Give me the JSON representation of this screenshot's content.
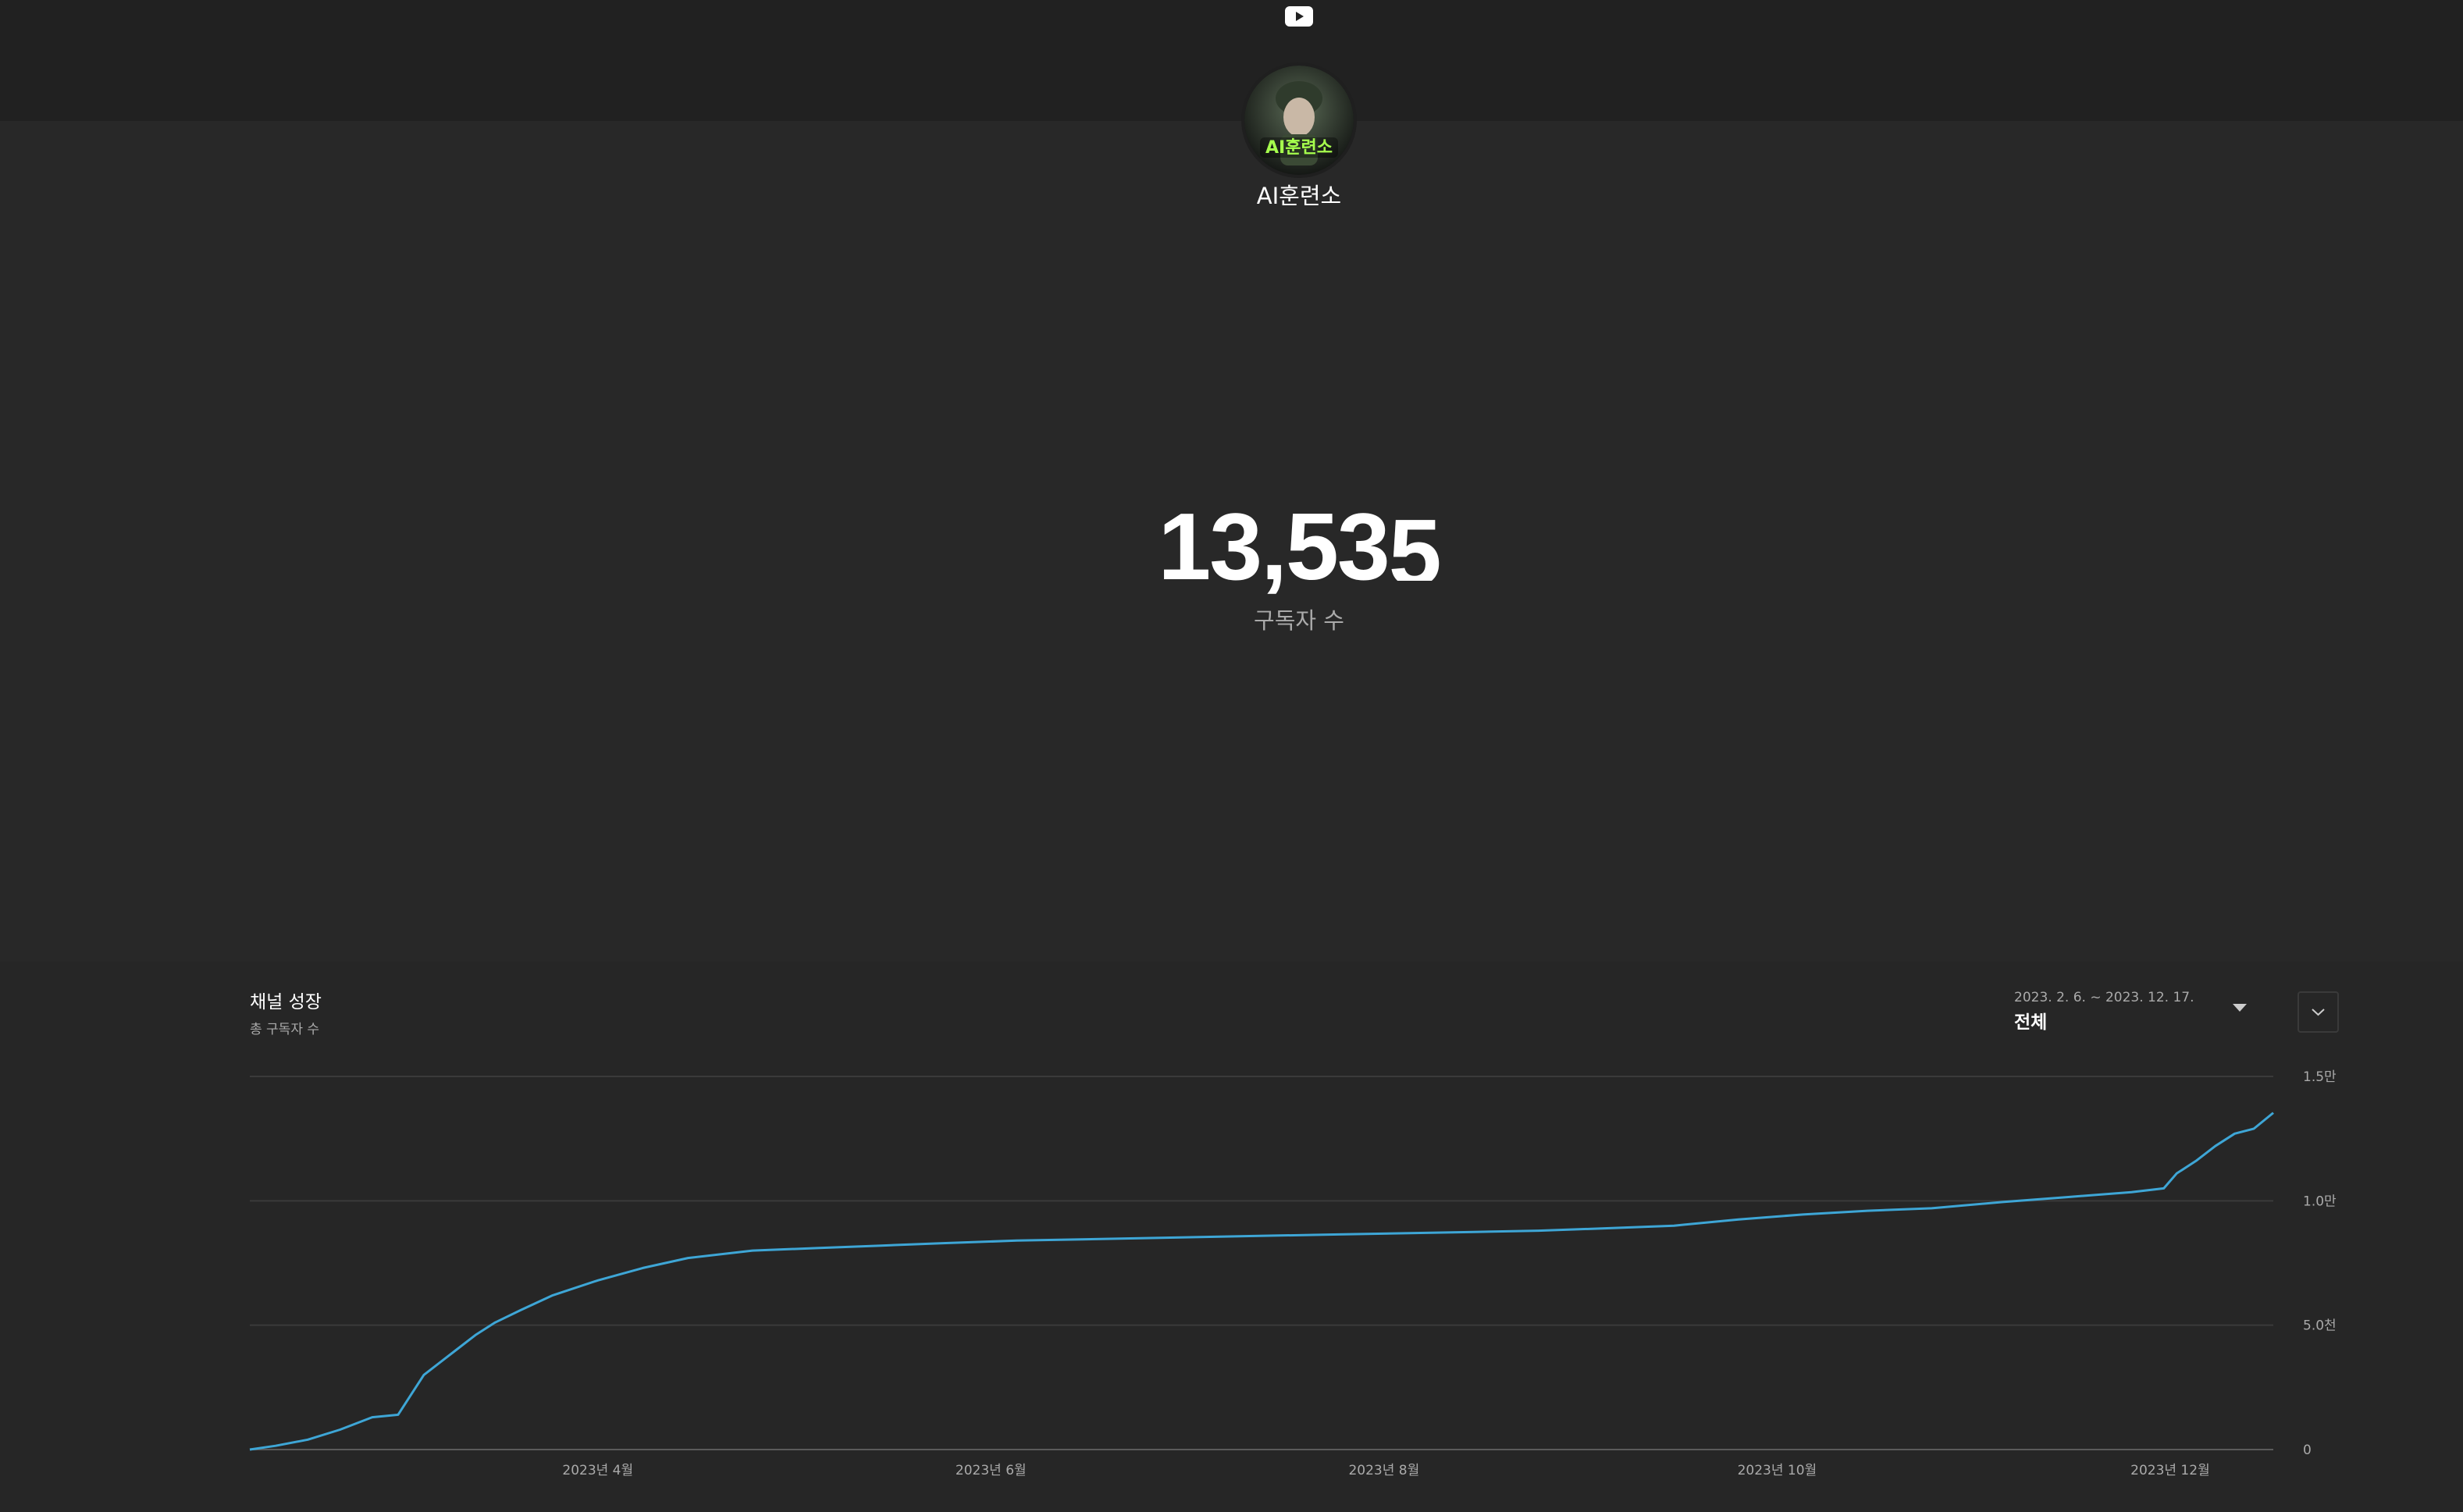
{
  "header": {
    "logo_icon": "youtube-play-icon",
    "channel_name": "AI훈련소",
    "avatar_text": "AI훈련소"
  },
  "subscriber": {
    "count": "13,53",
    "rolling_digit": "5",
    "label": "구독자 수"
  },
  "growth": {
    "title": "채널 성장",
    "subtitle": "총 구독자 수",
    "range_dates": "2023. 2. 6. ~ 2023. 12. 17.",
    "range_label": "전체",
    "expand_icon": "chevron-down-icon"
  },
  "colors": {
    "line": "#3ea6d6",
    "background": "#282828",
    "topbar": "#212121"
  },
  "chart_data": {
    "type": "line",
    "x_start": "2023-02-06",
    "x_end": "2023-12-17",
    "x": [
      "2023-02-06",
      "2023-02-10",
      "2023-02-15",
      "2023-02-20",
      "2023-02-25",
      "2023-03-01",
      "2023-03-05",
      "2023-03-08",
      "2023-03-10",
      "2023-03-13",
      "2023-03-16",
      "2023-03-20",
      "2023-03-25",
      "2023-04-01",
      "2023-04-08",
      "2023-04-15",
      "2023-04-25",
      "2023-05-05",
      "2023-05-15",
      "2023-05-25",
      "2023-06-05",
      "2023-06-15",
      "2023-06-25",
      "2023-07-05",
      "2023-07-15",
      "2023-07-25",
      "2023-08-05",
      "2023-08-15",
      "2023-08-25",
      "2023-09-05",
      "2023-09-15",
      "2023-09-25",
      "2023-10-05",
      "2023-10-15",
      "2023-10-25",
      "2023-11-05",
      "2023-11-15",
      "2023-11-25",
      "2023-11-30",
      "2023-12-02",
      "2023-12-05",
      "2023-12-08",
      "2023-12-11",
      "2023-12-14",
      "2023-12-17"
    ],
    "values": [
      0,
      150,
      400,
      800,
      1300,
      1400,
      3000,
      3600,
      4000,
      4600,
      5100,
      5600,
      6200,
      6800,
      7300,
      7700,
      8000,
      8100,
      8200,
      8300,
      8400,
      8450,
      8500,
      8550,
      8600,
      8650,
      8700,
      8750,
      8800,
      8900,
      9000,
      9250,
      9450,
      9600,
      9700,
      9950,
      10150,
      10350,
      10500,
      11100,
      11600,
      12200,
      12700,
      12900,
      13539
    ],
    "x_ticks": [
      "2023년 4월",
      "2023년 6월",
      "2023년 8월",
      "2023년 10월",
      "2023년 12월"
    ],
    "y_ticks": [
      "0",
      "5.0천",
      "1.0만",
      "1.5만"
    ],
    "ylim": [
      0,
      15000
    ],
    "grid": true
  }
}
